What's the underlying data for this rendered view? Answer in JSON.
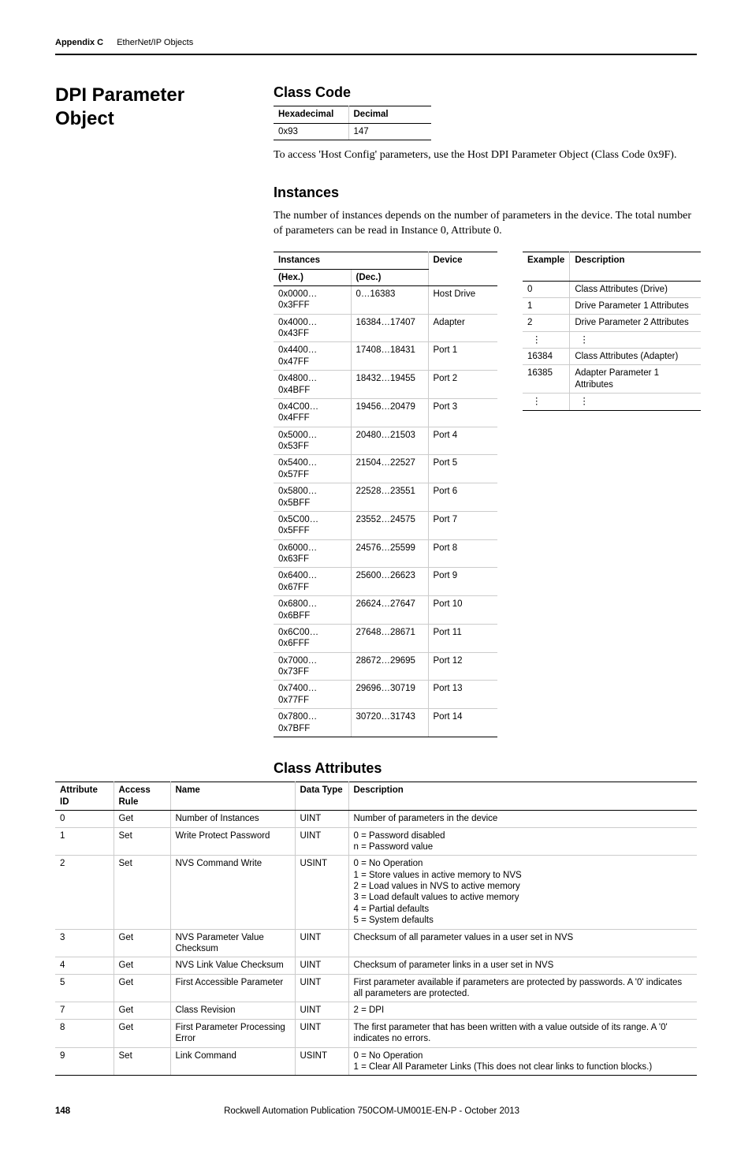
{
  "header": {
    "appendix": "Appendix C",
    "chapter": "EtherNet/IP Objects"
  },
  "section_title": "DPI Parameter Object",
  "class_code": {
    "heading": "Class Code",
    "th_hex": "Hexadecimal",
    "th_dec": "Decimal",
    "hex": "0x93",
    "dec": "147",
    "access_note": "To access 'Host Config' parameters, use the Host DPI Parameter Object (Class Code 0x9F)."
  },
  "instances": {
    "heading": "Instances",
    "intro": "The number of instances depends on the number of parameters in the device. The total number of parameters can be read in Instance 0, Attribute 0.",
    "th_instances": "Instances",
    "th_device": "Device",
    "th_hex": "(Hex.)",
    "th_dec": "(Dec.)",
    "rows": [
      {
        "hex": "0x0000…0x3FFF",
        "dec": "0…16383",
        "dev": "Host Drive"
      },
      {
        "hex": "0x4000…0x43FF",
        "dec": "16384…17407",
        "dev": "Adapter"
      },
      {
        "hex": "0x4400…0x47FF",
        "dec": "17408…18431",
        "dev": "Port 1"
      },
      {
        "hex": "0x4800…0x4BFF",
        "dec": "18432…19455",
        "dev": "Port 2"
      },
      {
        "hex": "0x4C00…0x4FFF",
        "dec": "19456…20479",
        "dev": "Port 3"
      },
      {
        "hex": "0x5000…0x53FF",
        "dec": "20480…21503",
        "dev": "Port 4"
      },
      {
        "hex": "0x5400…0x57FF",
        "dec": "21504…22527",
        "dev": "Port 5"
      },
      {
        "hex": "0x5800…0x5BFF",
        "dec": "22528…23551",
        "dev": "Port 6"
      },
      {
        "hex": "0x5C00…0x5FFF",
        "dec": "23552…24575",
        "dev": "Port 7"
      },
      {
        "hex": "0x6000…0x63FF",
        "dec": "24576…25599",
        "dev": "Port 8"
      },
      {
        "hex": "0x6400…0x67FF",
        "dec": "25600…26623",
        "dev": "Port 9"
      },
      {
        "hex": "0x6800…0x6BFF",
        "dec": "26624…27647",
        "dev": "Port 10"
      },
      {
        "hex": "0x6C00…0x6FFF",
        "dec": "27648…28671",
        "dev": "Port 11"
      },
      {
        "hex": "0x7000…0x73FF",
        "dec": "28672…29695",
        "dev": "Port 12"
      },
      {
        "hex": "0x7400…0x77FF",
        "dec": "29696…30719",
        "dev": "Port 13"
      },
      {
        "hex": "0x7800…0x7BFF",
        "dec": "30720…31743",
        "dev": "Port 14"
      }
    ],
    "example_th_example": "Example",
    "example_th_desc": "Description",
    "example_rows": [
      {
        "ex": "0",
        "desc": "Class Attributes (Drive)"
      },
      {
        "ex": "1",
        "desc": "Drive Parameter 1 Attributes"
      },
      {
        "ex": "2",
        "desc": "Drive Parameter 2 Attributes"
      },
      {
        "ex": "⋮",
        "desc": "⋮"
      },
      {
        "ex": "16384",
        "desc": "Class Attributes (Adapter)"
      },
      {
        "ex": "16385",
        "desc": "Adapter Parameter 1 Attributes"
      },
      {
        "ex": "⋮",
        "desc": "⋮"
      }
    ]
  },
  "class_attributes": {
    "heading": "Class Attributes",
    "th_id": "Attribute ID",
    "th_rule": "Access Rule",
    "th_name": "Name",
    "th_type": "Data Type",
    "th_desc": "Description",
    "rows": [
      {
        "id": "0",
        "rule": "Get",
        "name": "Number of Instances",
        "type": "UINT",
        "desc": [
          "Number of parameters in the device"
        ]
      },
      {
        "id": "1",
        "rule": "Set",
        "name": "Write Protect Password",
        "type": "UINT",
        "desc": [
          "0 = Password disabled",
          "n = Password value"
        ]
      },
      {
        "id": "2",
        "rule": "Set",
        "name": "NVS Command Write",
        "type": "USINT",
        "desc": [
          "0 = No Operation",
          "1 = Store values in active memory to NVS",
          "2 = Load values in NVS to active memory",
          "3 = Load default values to active memory",
          "4 = Partial defaults",
          "5 = System defaults"
        ]
      },
      {
        "id": "3",
        "rule": "Get",
        "name": "NVS Parameter Value Checksum",
        "type": "UINT",
        "desc": [
          "Checksum of all parameter values in a user set in NVS"
        ]
      },
      {
        "id": "4",
        "rule": "Get",
        "name": "NVS Link Value Checksum",
        "type": "UINT",
        "desc": [
          "Checksum of parameter links in a user set in NVS"
        ]
      },
      {
        "id": "5",
        "rule": "Get",
        "name": "First Accessible Parameter",
        "type": "UINT",
        "desc": [
          "First parameter available if parameters are protected by passwords. A '0' indicates all parameters are protected."
        ]
      },
      {
        "id": "7",
        "rule": "Get",
        "name": "Class Revision",
        "type": "UINT",
        "desc": [
          "2 = DPI"
        ]
      },
      {
        "id": "8",
        "rule": "Get",
        "name": "First Parameter Processing Error",
        "type": "UINT",
        "desc": [
          "The first parameter that has been written with a value outside of its range. A '0' indicates no errors."
        ]
      },
      {
        "id": "9",
        "rule": "Set",
        "name": "Link Command",
        "type": "USINT",
        "desc": [
          "0 = No Operation",
          "1 = Clear All Parameter Links (This does not clear links to function blocks.)"
        ]
      }
    ]
  },
  "footer": {
    "page": "148",
    "pub": "Rockwell Automation Publication 750COM-UM001E-EN-P - October 2013"
  }
}
